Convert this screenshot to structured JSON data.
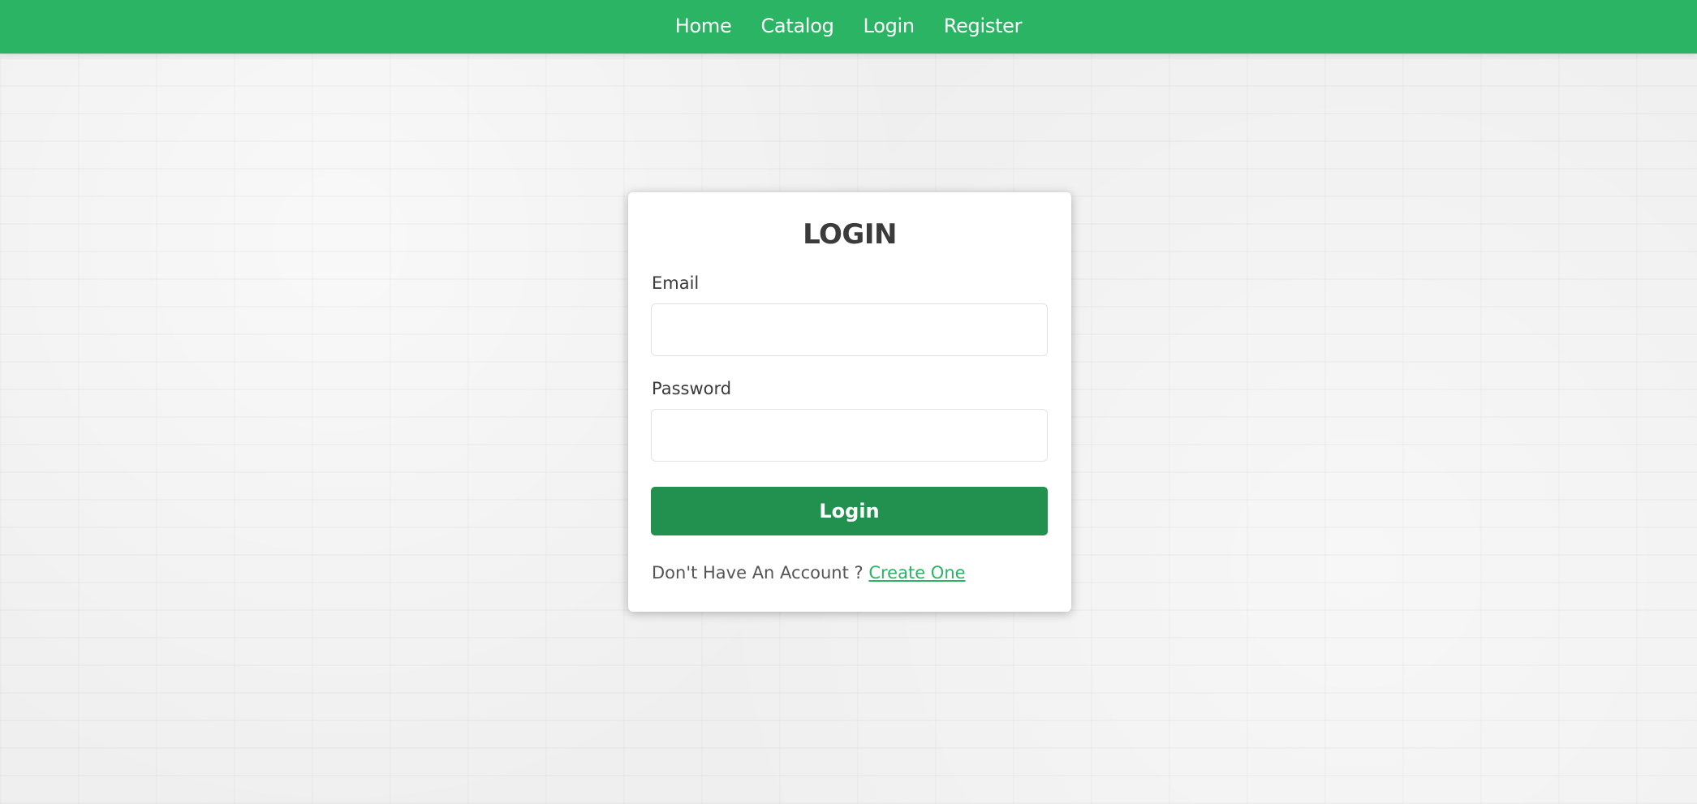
{
  "nav": {
    "items": [
      {
        "label": "Home"
      },
      {
        "label": "Catalog"
      },
      {
        "label": "Login"
      },
      {
        "label": "Register"
      }
    ]
  },
  "login_form": {
    "title": "LOGIN",
    "email_label": "Email",
    "email_value": "",
    "password_label": "Password",
    "password_value": "",
    "submit_label": "Login",
    "signup_prompt": "Don't Have An Account ?",
    "signup_link": "Create One"
  },
  "colors": {
    "navbar": "#2ab463",
    "button": "#229150",
    "link": "#2ab463"
  }
}
